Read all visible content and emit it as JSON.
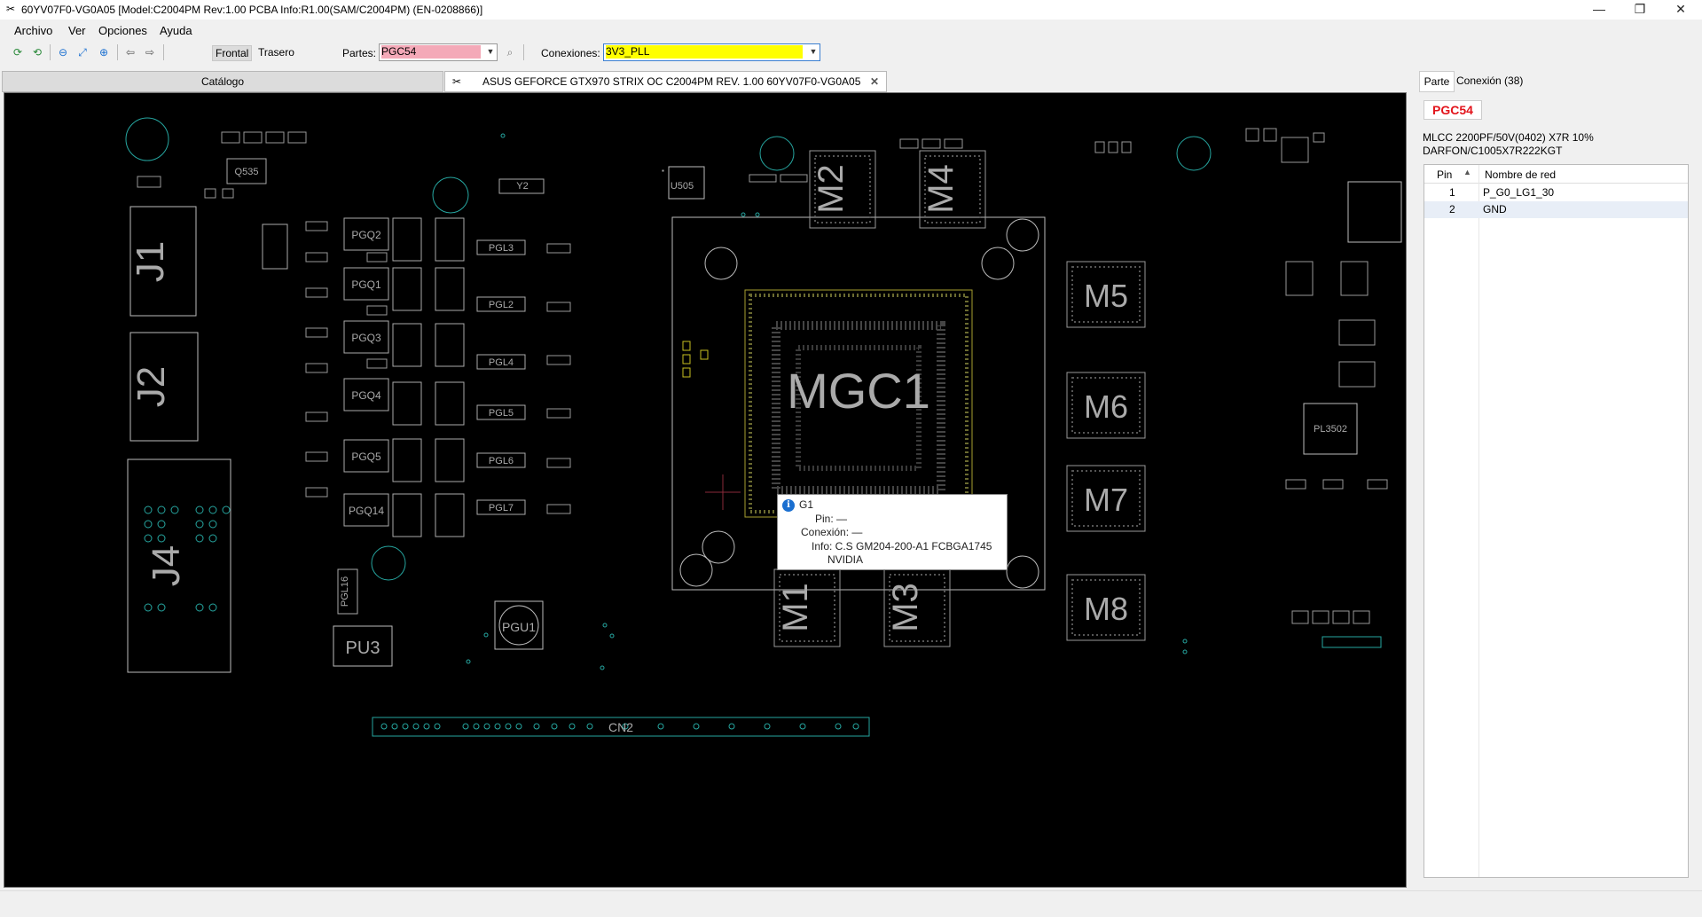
{
  "window": {
    "title": "60YV07F0-VG0A05 [Model:C2004PM Rev:1.00 PCBA Info:R1.00(SAM/C2004PM) (EN-0208866)]",
    "app_icon": "scissors-icon",
    "minimize_icon": "minimize-icon",
    "maximize_icon": "restore-icon",
    "close_icon": "close-icon"
  },
  "menu": {
    "items": [
      "Archivo",
      "Ver",
      "Opciones",
      "Ayuda"
    ]
  },
  "toolbar": {
    "buttons": [
      "refresh-green-icon",
      "refresh-icon",
      "zoom-out-icon",
      "fit-icon",
      "zoom-in-icon",
      "back-arrow-icon",
      "forward-arrow-icon"
    ],
    "frontal": "Frontal",
    "trasero": "Trasero",
    "partes_label": "Partes:",
    "partes_value": "PGC54",
    "partes_color": "#f4a9b8",
    "conexiones_label": "Conexiones:",
    "conexiones_value": "3V3_PLL",
    "conexiones_color": "#ffff00"
  },
  "tabs": {
    "catalog": "Catálogo",
    "board": "ASUS GEFORCE GTX970 STRIX OC C2004PM REV. 1.00 60YV07F0-VG0A05"
  },
  "board": {
    "labels": [
      "MGC1",
      "M1",
      "M2",
      "M3",
      "M4",
      "M5",
      "M6",
      "M7",
      "M8",
      "J1",
      "J2",
      "J4",
      "PU3",
      "PGU1",
      "CN2",
      "U505",
      "Q535",
      "Y2",
      "PL3502",
      "PGQ2",
      "PGQ1",
      "PGQ3",
      "PGQ4",
      "PGQ5",
      "PGQ14",
      "PGL3",
      "PGL2",
      "PGL4",
      "PGL5",
      "PGL6",
      "PGL7",
      "PGL16"
    ],
    "accent_color": "#26a6a0",
    "outline_color": "#bbbbbb"
  },
  "tooltip": {
    "name": "G1",
    "pin": "Pin: —",
    "connection": "Conexión: —",
    "info1": "Info: C.S GM204-200-A1 FCBGA1745",
    "info2": "NVIDIA"
  },
  "panel": {
    "tab_parte": "Parte",
    "tab_conexion": "Conexión (38)",
    "part_name": "PGC54",
    "part_desc1": "MLCC 2200PF/50V(0402) X7R 10%",
    "part_desc2": "DARFON/C1005X7R222KGT",
    "col_pin": "Pin",
    "col_net": "Nombre de red",
    "rows": [
      {
        "pin": "1",
        "net": "P_G0_LG1_30"
      },
      {
        "pin": "2",
        "net": "GND"
      }
    ]
  }
}
